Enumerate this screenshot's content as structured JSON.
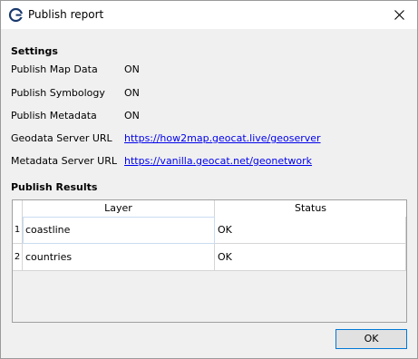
{
  "window": {
    "title": "Publish report"
  },
  "settings": {
    "heading": "Settings",
    "rows": [
      {
        "label": "Publish Map Data",
        "value": "ON"
      },
      {
        "label": "Publish Symbology",
        "value": "ON"
      },
      {
        "label": "Publish Metadata",
        "value": "ON"
      },
      {
        "label": "Geodata Server URL",
        "value": "https://how2map.geocat.live/geoserver"
      },
      {
        "label": "Metadata Server URL",
        "value": "https://vanilla.geocat.net/geonetwork"
      }
    ]
  },
  "results": {
    "heading": "Publish Results",
    "columns": [
      "Layer",
      "Status"
    ],
    "rows": [
      {
        "num": "1",
        "layer": "coastline",
        "status": "OK"
      },
      {
        "num": "2",
        "layer": "countries",
        "status": "OK"
      }
    ]
  },
  "footer": {
    "ok_label": "OK"
  },
  "colors": {
    "link": "#0000ee",
    "focus_border": "#0078d7",
    "app_icon": "#1a3a6e"
  }
}
